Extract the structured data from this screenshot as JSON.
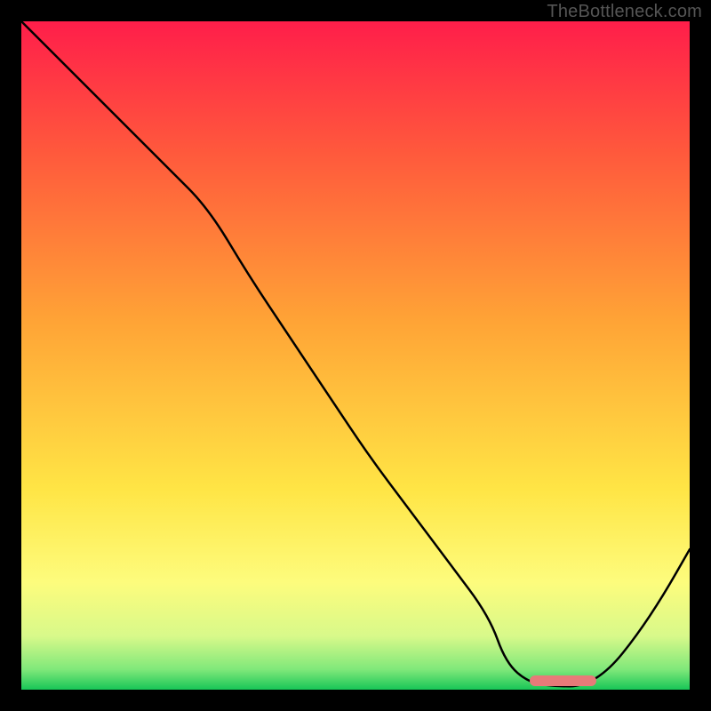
{
  "watermark": "TheBottleneck.com",
  "chart_data": {
    "type": "line",
    "title": "",
    "xlabel": "",
    "ylabel": "",
    "xlim": [
      0,
      100
    ],
    "ylim": [
      0,
      100
    ],
    "grid": false,
    "legend": false,
    "background_gradient_stops": [
      {
        "pct": 0,
        "color": "#ff1e4a"
      },
      {
        "pct": 20,
        "color": "#ff5a3c"
      },
      {
        "pct": 45,
        "color": "#ffa436"
      },
      {
        "pct": 70,
        "color": "#ffe545"
      },
      {
        "pct": 84,
        "color": "#fdfc7d"
      },
      {
        "pct": 92,
        "color": "#d8f98a"
      },
      {
        "pct": 97,
        "color": "#7fe87a"
      },
      {
        "pct": 100,
        "color": "#18c657"
      }
    ],
    "series": [
      {
        "name": "bottleneck-curve",
        "color": "#000000",
        "width": 2.5,
        "x": [
          0,
          4,
          10,
          16,
          22,
          28,
          34,
          40,
          46,
          52,
          58,
          64,
          70,
          72.5,
          76,
          80,
          84,
          88,
          92,
          96,
          100
        ],
        "y": [
          100,
          96,
          90,
          84,
          78,
          72,
          62,
          53,
          44,
          35,
          27,
          19,
          11,
          4,
          1,
          0.5,
          0.5,
          3,
          8,
          14,
          21
        ]
      }
    ],
    "annotations": [
      {
        "name": "optimal-range-marker",
        "type": "hbar",
        "color": "#e77a79",
        "x0": 76,
        "x1": 86,
        "y": 1.3
      }
    ]
  }
}
